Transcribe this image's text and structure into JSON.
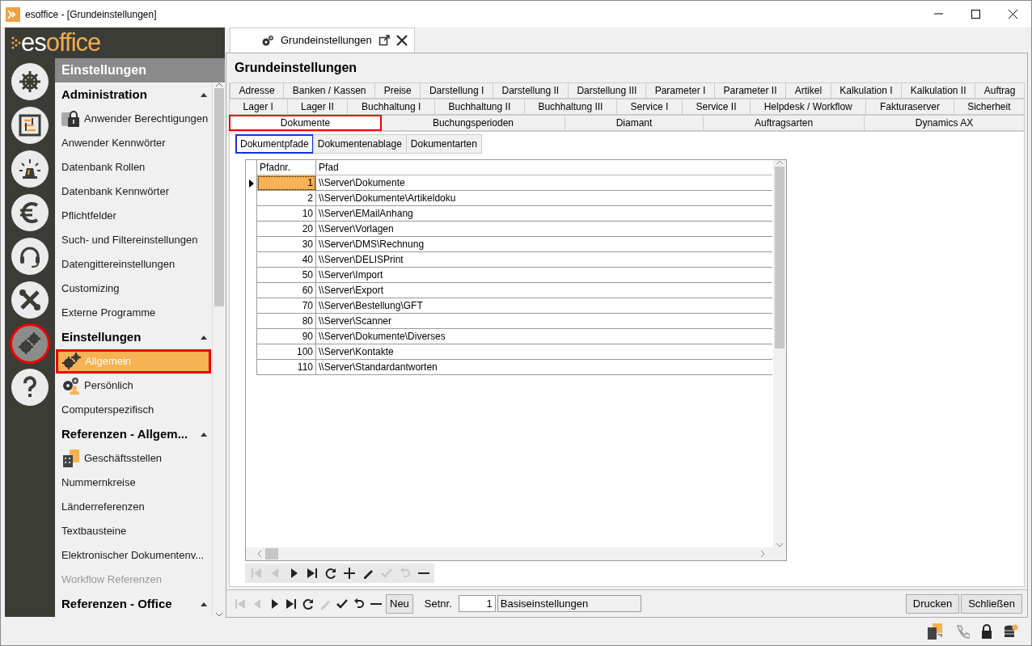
{
  "window": {
    "title": "esoffice - [Grundeinstellungen]"
  },
  "logo": {
    "prefix": "es",
    "suffix": "office"
  },
  "nav_icons": [
    {
      "kind": "helm",
      "selected": false
    },
    {
      "kind": "board",
      "selected": false
    },
    {
      "kind": "alarm",
      "selected": false
    },
    {
      "kind": "euro",
      "selected": false
    },
    {
      "kind": "headset",
      "selected": false
    },
    {
      "kind": "tools",
      "selected": false
    },
    {
      "kind": "gears",
      "selected": true
    },
    {
      "kind": "help",
      "selected": false
    }
  ],
  "menu": {
    "title": "Einstellungen",
    "sections": [
      {
        "title": "Administration",
        "expanded": true,
        "items": [
          {
            "label": "Anwender Berechtigungen",
            "kind": "lock",
            "selected": false,
            "disabled": false
          },
          {
            "label": "Anwender Kennwörter",
            "selected": false,
            "disabled": false
          },
          {
            "label": "Datenbank Rollen",
            "selected": false,
            "disabled": false
          },
          {
            "label": "Datenbank Kennwörter",
            "selected": false,
            "disabled": false
          },
          {
            "label": "Pflichtfelder",
            "selected": false,
            "disabled": false
          },
          {
            "label": "Such- und Filtereinstellungen",
            "selected": false,
            "disabled": false
          },
          {
            "label": "Datengittereinstellungen",
            "selected": false,
            "disabled": false
          },
          {
            "label": "Customizing",
            "selected": false,
            "disabled": false
          },
          {
            "label": "Externe Programme",
            "selected": false,
            "disabled": false
          }
        ]
      },
      {
        "title": "Einstellungen",
        "expanded": true,
        "items": [
          {
            "label": "Allgemein",
            "kind": "gears",
            "selected": true,
            "disabled": false
          },
          {
            "label": "Persönlich",
            "kind": "gears-person",
            "selected": false,
            "disabled": false
          },
          {
            "label": "Computerspezifisch",
            "selected": false,
            "disabled": false
          }
        ]
      },
      {
        "title": "Referenzen - Allgem...",
        "expanded": true,
        "items": [
          {
            "label": "Geschäftsstellen",
            "kind": "building",
            "selected": false,
            "disabled": false
          },
          {
            "label": "Nummernkreise",
            "selected": false,
            "disabled": false
          },
          {
            "label": "Länderreferenzen",
            "selected": false,
            "disabled": false
          },
          {
            "label": "Textbausteine",
            "selected": false,
            "disabled": false
          },
          {
            "label": "Elektronischer Dokumentenv...",
            "selected": false,
            "disabled": false
          },
          {
            "label": "Workflow Referenzen",
            "selected": false,
            "disabled": true
          }
        ]
      },
      {
        "title": "Referenzen - Office",
        "expanded": true
      }
    ]
  },
  "doc_tab": {
    "label": "Grundeinstellungen"
  },
  "page_title": "Grundeinstellungen",
  "tab_rows": [
    [
      {
        "label": "Adresse",
        "selected": false
      },
      {
        "label": "Banken / Kassen",
        "selected": false
      },
      {
        "label": "Preise",
        "selected": false
      },
      {
        "label": "Darstellung I",
        "selected": false
      },
      {
        "label": "Darstellung II",
        "selected": false
      },
      {
        "label": "Darstellung III",
        "selected": false
      },
      {
        "label": "Parameter I",
        "selected": false
      },
      {
        "label": "Parameter II",
        "selected": false
      },
      {
        "label": "Artikel",
        "selected": false
      },
      {
        "label": "Kalkulation I",
        "selected": false
      },
      {
        "label": "Kalkulation II",
        "selected": false
      },
      {
        "label": "Auftrag",
        "selected": false
      }
    ],
    [
      {
        "label": "Lager I",
        "selected": false
      },
      {
        "label": "Lager II",
        "selected": false
      },
      {
        "label": "Buchhaltung I",
        "selected": false
      },
      {
        "label": "Buchhaltung II",
        "selected": false
      },
      {
        "label": "Buchhaltung III",
        "selected": false
      },
      {
        "label": "Service I",
        "selected": false
      },
      {
        "label": "Service II",
        "selected": false
      },
      {
        "label": "Helpdesk / Workflow",
        "selected": false
      },
      {
        "label": "Fakturaserver",
        "selected": false
      },
      {
        "label": "Sicherheit",
        "selected": false
      }
    ],
    [
      {
        "label": "Dokumente",
        "selected": true
      },
      {
        "label": "Buchungsperioden",
        "selected": false
      },
      {
        "label": "Diamant",
        "selected": false
      },
      {
        "label": "Auftragsarten",
        "selected": false
      },
      {
        "label": "Dynamics AX",
        "selected": false
      }
    ]
  ],
  "sub_tabs": [
    {
      "label": "Dokumentpfade",
      "selected": true
    },
    {
      "label": "Dokumentenablage",
      "selected": false
    },
    {
      "label": "Dokumentarten",
      "selected": false
    }
  ],
  "table": {
    "columns": [
      "Pfadnr.",
      "Pfad"
    ],
    "rows": [
      {
        "nr": "1",
        "path": "\\\\Server\\Dokumente",
        "selected": true
      },
      {
        "nr": "2",
        "path": "\\\\Server\\Dokumente\\Artikeldoku",
        "selected": false
      },
      {
        "nr": "10",
        "path": "\\\\Server\\EMailAnhang",
        "selected": false
      },
      {
        "nr": "20",
        "path": "\\\\Server\\Vorlagen",
        "selected": false
      },
      {
        "nr": "30",
        "path": "\\\\Server\\DMS\\Rechnung",
        "selected": false
      },
      {
        "nr": "40",
        "path": "\\\\Server\\DELISPrint",
        "selected": false
      },
      {
        "nr": "50",
        "path": "\\\\Server\\Import",
        "selected": false
      },
      {
        "nr": "60",
        "path": "\\\\Server\\Export",
        "selected": false
      },
      {
        "nr": "70",
        "path": "\\\\Server\\Bestellung\\GFT",
        "selected": false
      },
      {
        "nr": "80",
        "path": "\\\\Server\\Scanner",
        "selected": false
      },
      {
        "nr": "90",
        "path": "\\\\Server\\Dokumente\\Diverses",
        "selected": false
      },
      {
        "nr": "100",
        "path": "\\\\Server\\Kontakte",
        "selected": false
      },
      {
        "nr": "110",
        "path": "\\\\Server\\Standardantworten",
        "selected": false
      }
    ]
  },
  "grid_toolbar": [
    {
      "kind": "first",
      "disabled": true
    },
    {
      "kind": "prev",
      "disabled": true
    },
    {
      "kind": "next",
      "disabled": false
    },
    {
      "kind": "last",
      "disabled": false
    },
    {
      "kind": "refresh",
      "disabled": false
    },
    {
      "kind": "add",
      "disabled": false
    },
    {
      "kind": "edit",
      "disabled": false
    },
    {
      "kind": "check",
      "disabled": true
    },
    {
      "kind": "undo",
      "disabled": true
    },
    {
      "kind": "remove",
      "disabled": false
    }
  ],
  "bottom_toolbar": [
    {
      "kind": "first",
      "disabled": true
    },
    {
      "kind": "prev",
      "disabled": true
    },
    {
      "kind": "next",
      "disabled": false
    },
    {
      "kind": "last",
      "disabled": false
    },
    {
      "kind": "refresh",
      "disabled": false
    },
    {
      "kind": "edit",
      "disabled": true
    },
    {
      "kind": "check",
      "disabled": false
    },
    {
      "kind": "undo",
      "disabled": false
    },
    {
      "kind": "remove",
      "disabled": false
    }
  ],
  "new_button": "Neu",
  "setnr": {
    "label": "Setnr.",
    "value": "1",
    "name": "Basiseinstellungen"
  },
  "buttons": [
    "Drucken",
    "Schließen"
  ]
}
